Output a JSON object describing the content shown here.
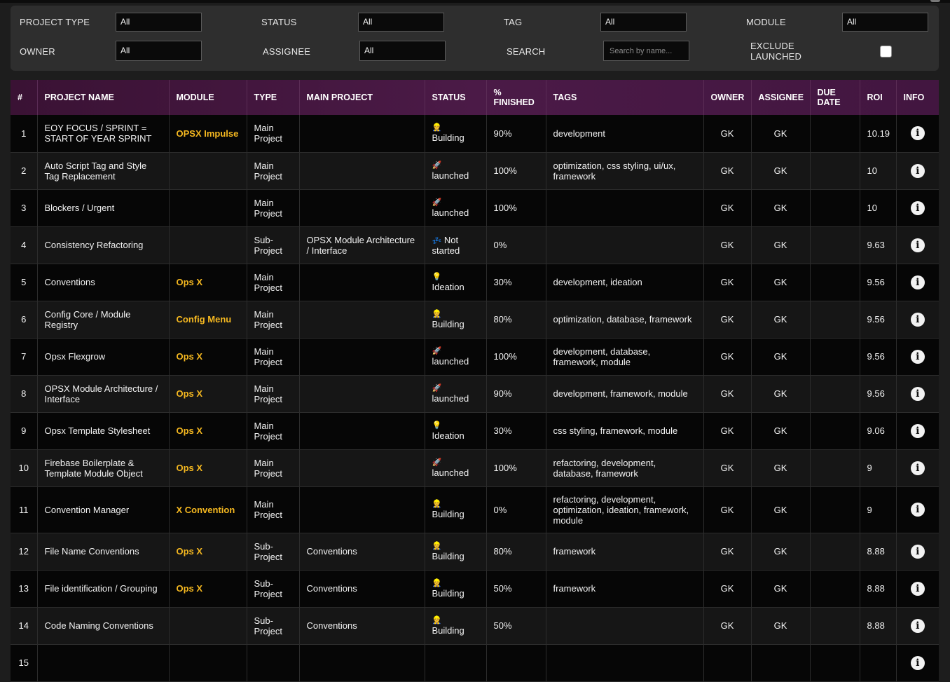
{
  "filters": {
    "project_type": {
      "label": "PROJECT TYPE",
      "value": "All"
    },
    "status": {
      "label": "STATUS",
      "value": "All"
    },
    "tag": {
      "label": "TAG",
      "value": "All"
    },
    "module": {
      "label": "MODULE",
      "value": "All"
    },
    "owner": {
      "label": "OWNER",
      "value": "All"
    },
    "assignee": {
      "label": "ASSIGNEE",
      "value": "All"
    },
    "search": {
      "label": "SEARCH",
      "placeholder": "Search by name..."
    },
    "exclude_launched": {
      "label_line1": "EXCLUDE",
      "label_line2": "LAUNCHED",
      "checked": false
    }
  },
  "table": {
    "headers": {
      "num": "#",
      "name": "PROJECT NAME",
      "module": "MODULE",
      "type": "TYPE",
      "main_project": "MAIN PROJECT",
      "status": "STATUS",
      "finished_line1": "%",
      "finished_line2": "FINISHED",
      "tags": "TAGS",
      "owner": "OWNER",
      "assignee": "ASSIGNEE",
      "due_line1": "DUE",
      "due_line2": "DATE",
      "roi": "ROI",
      "info": "INFO"
    },
    "status_icons": {
      "Building": "👷",
      "launched": "🚀",
      "Ideation": "💡",
      "Not started": "💤"
    },
    "rows": [
      {
        "num": "1",
        "name": "EOY FOCUS / SPRINT = START OF YEAR SPRINT",
        "module": "OPSX Impulse",
        "type": "Main Project",
        "main_project": "",
        "status": "Building",
        "finished": "90%",
        "tags": "development",
        "owner": "GK",
        "assignee": "GK",
        "due_date": "",
        "roi": "10.19"
      },
      {
        "num": "2",
        "name": "Auto Script Tag and Style Tag Replacement",
        "module": "",
        "type": "Main Project",
        "main_project": "",
        "status": "launched",
        "finished": "100%",
        "tags": "optimization, css styling, ui/ux, framework",
        "owner": "GK",
        "assignee": "GK",
        "due_date": "",
        "roi": "10"
      },
      {
        "num": "3",
        "name": "Blockers / Urgent",
        "module": "",
        "type": "Main Project",
        "main_project": "",
        "status": "launched",
        "finished": "100%",
        "tags": "",
        "owner": "GK",
        "assignee": "GK",
        "due_date": "",
        "roi": "10"
      },
      {
        "num": "4",
        "name": "Consistency Refactoring",
        "module": "",
        "type": "Sub-Project",
        "main_project": "OPSX Module Architecture / Interface",
        "status": "Not started",
        "finished": "0%",
        "tags": "",
        "owner": "GK",
        "assignee": "GK",
        "due_date": "",
        "roi": "9.63"
      },
      {
        "num": "5",
        "name": "Conventions",
        "module": "Ops X",
        "type": "Main Project",
        "main_project": "",
        "status": "Ideation",
        "finished": "30%",
        "tags": "development, ideation",
        "owner": "GK",
        "assignee": "GK",
        "due_date": "",
        "roi": "9.56"
      },
      {
        "num": "6",
        "name": "Config Core / Module Registry",
        "module": "Config Menu",
        "type": "Main Project",
        "main_project": "",
        "status": "Building",
        "finished": "80%",
        "tags": "optimization, database, framework",
        "owner": "GK",
        "assignee": "GK",
        "due_date": "",
        "roi": "9.56"
      },
      {
        "num": "7",
        "name": "Opsx Flexgrow",
        "module": "Ops X",
        "type": "Main Project",
        "main_project": "",
        "status": "launched",
        "finished": "100%",
        "tags": "development, database, framework, module",
        "owner": "GK",
        "assignee": "GK",
        "due_date": "",
        "roi": "9.56"
      },
      {
        "num": "8",
        "name": "OPSX Module Architecture / Interface",
        "module": "Ops X",
        "type": "Main Project",
        "main_project": "",
        "status": "launched",
        "finished": "90%",
        "tags": "development, framework, module",
        "owner": "GK",
        "assignee": "GK",
        "due_date": "",
        "roi": "9.56"
      },
      {
        "num": "9",
        "name": "Opsx Template Stylesheet",
        "module": "Ops X",
        "type": "Main Project",
        "main_project": "",
        "status": "Ideation",
        "finished": "30%",
        "tags": "css styling, framework, module",
        "owner": "GK",
        "assignee": "GK",
        "due_date": "",
        "roi": "9.06"
      },
      {
        "num": "10",
        "name": "Firebase Boilerplate & Template Module Object",
        "module": "Ops X",
        "type": "Main Project",
        "main_project": "",
        "status": "launched",
        "finished": "100%",
        "tags": "refactoring, development, database, framework",
        "owner": "GK",
        "assignee": "GK",
        "due_date": "",
        "roi": "9"
      },
      {
        "num": "11",
        "name": "Convention Manager",
        "module": "X Convention",
        "type": "Main Project",
        "main_project": "",
        "status": "Building",
        "finished": "0%",
        "tags": "refactoring, development, optimization, ideation, framework, module",
        "owner": "GK",
        "assignee": "GK",
        "due_date": "",
        "roi": "9"
      },
      {
        "num": "12",
        "name": "File Name Conventions",
        "module": "Ops X",
        "type": "Sub-Project",
        "main_project": "Conventions",
        "status": "Building",
        "finished": "80%",
        "tags": "framework",
        "owner": "GK",
        "assignee": "GK",
        "due_date": "",
        "roi": "8.88"
      },
      {
        "num": "13",
        "name": "File identification / Grouping",
        "module": "Ops X",
        "type": "Sub-Project",
        "main_project": "Conventions",
        "status": "Building",
        "finished": "50%",
        "tags": "framework",
        "owner": "GK",
        "assignee": "GK",
        "due_date": "",
        "roi": "8.88"
      },
      {
        "num": "14",
        "name": "Code Naming Conventions",
        "module": "",
        "type": "Sub-Project",
        "main_project": "Conventions",
        "status": "Building",
        "finished": "50%",
        "tags": "",
        "owner": "GK",
        "assignee": "GK",
        "due_date": "",
        "roi": "8.88"
      },
      {
        "num": "15",
        "name": "",
        "module": "",
        "type": "",
        "main_project": "",
        "status": "",
        "finished": "",
        "tags": "",
        "owner": "",
        "assignee": "",
        "due_date": "",
        "roi": ""
      }
    ]
  },
  "colors": {
    "header_bg": "#4b1a47",
    "module_text": "#f5b820",
    "filter_panel_bg": "#2e2e2e"
  }
}
